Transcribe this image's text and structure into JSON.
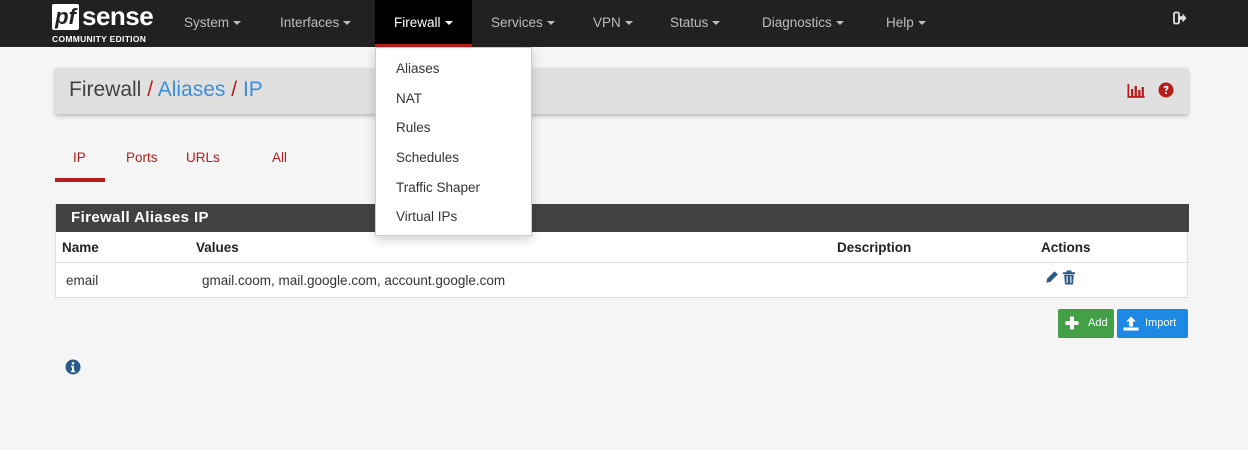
{
  "brand": {
    "logo_pf": "pf",
    "logo_sense": "sense",
    "edition": "COMMUNITY EDITION"
  },
  "nav": {
    "items": [
      {
        "label": "System"
      },
      {
        "label": "Interfaces"
      },
      {
        "label": "Firewall"
      },
      {
        "label": "Services"
      },
      {
        "label": "VPN"
      },
      {
        "label": "Status"
      },
      {
        "label": "Diagnostics"
      },
      {
        "label": "Help"
      }
    ],
    "active": "Firewall",
    "logout_icon": "sign-out-icon"
  },
  "dropdown": {
    "items": [
      {
        "label": "Aliases"
      },
      {
        "label": "NAT"
      },
      {
        "label": "Rules"
      },
      {
        "label": "Schedules"
      },
      {
        "label": "Traffic Shaper"
      },
      {
        "label": "Virtual IPs"
      }
    ]
  },
  "breadcrumb": {
    "part1": "Firewall",
    "part2": "Aliases",
    "part3": "IP",
    "separator": "/",
    "icons": [
      "bar-chart-icon",
      "help-icon"
    ]
  },
  "tabs": {
    "items": [
      {
        "label": "IP"
      },
      {
        "label": "Ports"
      },
      {
        "label": "URLs"
      },
      {
        "label": "All"
      }
    ],
    "active": "IP"
  },
  "table": {
    "title": "Firewall Aliases IP",
    "headers": {
      "name": "Name",
      "values": "Values",
      "description": "Description",
      "actions": "Actions"
    },
    "rows": [
      {
        "name": "email",
        "values": "gmail.coom, mail.google.com, account.google.com",
        "description": "",
        "actions": [
          "edit-icon",
          "trash-icon"
        ]
      }
    ]
  },
  "buttons": {
    "add": "Add",
    "import": "Import"
  },
  "colors": {
    "navbar": "#212121",
    "accent_red": "#b71c1c",
    "link_blue": "#3b8ed8",
    "panel_heading": "#424242",
    "add_green": "#43a047",
    "import_blue": "#1e88e5",
    "info_blue": "#2a5a88"
  }
}
